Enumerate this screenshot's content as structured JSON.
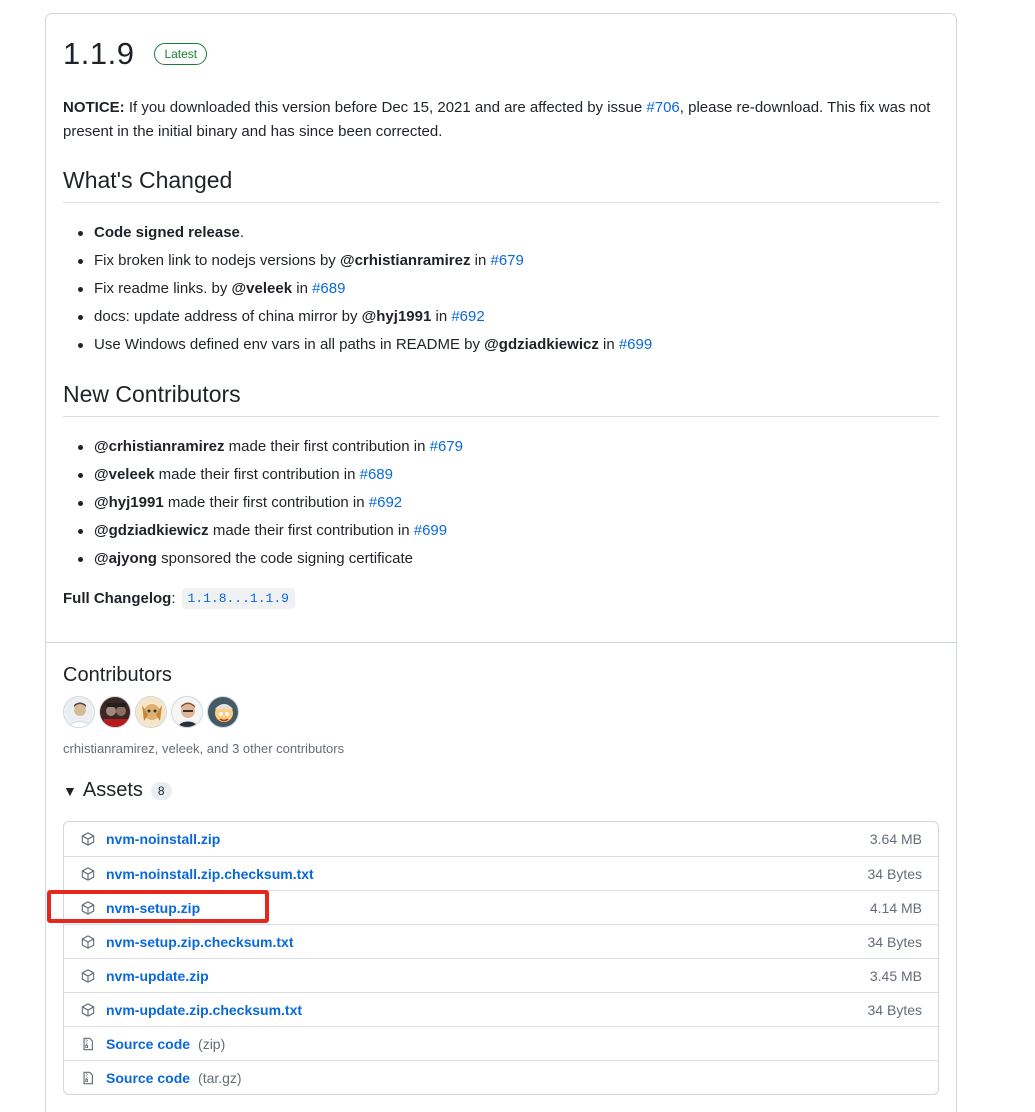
{
  "release": {
    "version": "1.1.9",
    "badge": "Latest",
    "notice_label": "NOTICE:",
    "notice_text_1": " If you downloaded this version before Dec 15, 2021 and are affected by issue ",
    "notice_issue": "#706",
    "notice_text_2": ", please re-download. This fix was not present in the initial binary and has since been corrected."
  },
  "whats_changed": {
    "heading": "What's Changed",
    "items": [
      {
        "bold": "Code signed release",
        "text": "."
      },
      {
        "text": "Fix broken link to nodejs versions by ",
        "user": "@crhistianramirez",
        "in": " in ",
        "pr": "#679"
      },
      {
        "text": "Fix readme links. by ",
        "user": "@veleek",
        "in": " in ",
        "pr": "#689"
      },
      {
        "text": "docs: update address of china mirror by ",
        "user": "@hyj1991",
        "in": " in ",
        "pr": "#692"
      },
      {
        "text": "Use Windows defined env vars in all paths in README by ",
        "user": "@gdziadkiewicz",
        "in": " in ",
        "pr": "#699"
      }
    ]
  },
  "new_contributors": {
    "heading": "New Contributors",
    "items": [
      {
        "user": "@crhistianramirez",
        "text": " made their first contribution in ",
        "pr": "#679"
      },
      {
        "user": "@veleek",
        "text": " made their first contribution in ",
        "pr": "#689"
      },
      {
        "user": "@hyj1991",
        "text": " made their first contribution in ",
        "pr": "#692"
      },
      {
        "user": "@gdziadkiewicz",
        "text": " made their first contribution in ",
        "pr": "#699"
      },
      {
        "user": "@ajyong",
        "text": " sponsored the code signing certificate",
        "pr": ""
      }
    ]
  },
  "changelog": {
    "label": "Full Changelog",
    "colon": ":",
    "value": "1.1.8...1.1.9"
  },
  "contributors": {
    "heading": "Contributors",
    "summary": "crhistianramirez, veleek, and 3 other contributors",
    "avatar_colors": [
      "#cfd8dc",
      "#3e2723",
      "#c9a15a",
      "#8d6e63",
      "#455a64"
    ]
  },
  "assets": {
    "heading": "Assets",
    "count": "8",
    "items": [
      {
        "name": "nvm-noinstall.zip",
        "size": "3.64 MB",
        "icon": "package-icon"
      },
      {
        "name": "nvm-noinstall.zip.checksum.txt",
        "size": "34 Bytes",
        "icon": "package-icon"
      },
      {
        "name": "nvm-setup.zip",
        "size": "4.14 MB",
        "icon": "package-icon"
      },
      {
        "name": "nvm-setup.zip.checksum.txt",
        "size": "34 Bytes",
        "icon": "package-icon"
      },
      {
        "name": "nvm-update.zip",
        "size": "3.45 MB",
        "icon": "package-icon"
      },
      {
        "name": "nvm-update.zip.checksum.txt",
        "size": "34 Bytes",
        "icon": "package-icon"
      },
      {
        "name": "Source code",
        "ext": "(zip)",
        "icon": "file-zip-icon"
      },
      {
        "name": "Source code",
        "ext": "(tar.gz)",
        "icon": "file-zip-icon"
      }
    ]
  },
  "colors": {
    "link": "#0969da",
    "latest_badge": "#1a7f37",
    "highlight": "#e5281e"
  }
}
